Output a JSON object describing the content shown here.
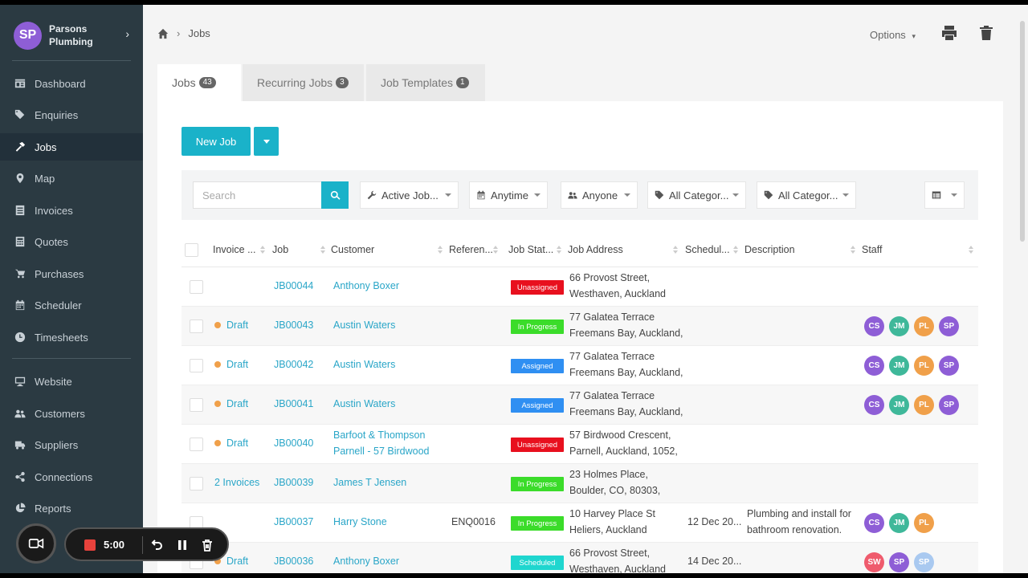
{
  "sidebar": {
    "brand": {
      "initials": "SP",
      "name": "Parsons Plumbing"
    },
    "items": [
      {
        "label": "Dashboard",
        "icon": "dashboard-icon"
      },
      {
        "label": "Enquiries",
        "icon": "tags-icon"
      },
      {
        "label": "Jobs",
        "icon": "hammer-icon",
        "active": true
      },
      {
        "label": "Map",
        "icon": "map-marker-icon"
      },
      {
        "label": "Invoices",
        "icon": "invoice-icon"
      },
      {
        "label": "Quotes",
        "icon": "calculator-icon"
      },
      {
        "label": "Purchases",
        "icon": "cart-icon"
      },
      {
        "label": "Scheduler",
        "icon": "calendar-icon"
      },
      {
        "label": "Timesheets",
        "icon": "clock-icon"
      },
      {
        "label": "Website",
        "icon": "monitor-icon"
      },
      {
        "label": "Customers",
        "icon": "users-icon"
      },
      {
        "label": "Suppliers",
        "icon": "truck-icon"
      },
      {
        "label": "Connections",
        "icon": "share-icon"
      },
      {
        "label": "Reports",
        "icon": "pie-chart-icon"
      }
    ]
  },
  "header": {
    "breadcrumb": "Jobs",
    "options_label": "Options"
  },
  "tabs": [
    {
      "label": "Jobs",
      "count": "43"
    },
    {
      "label": "Recurring Jobs",
      "count": "3"
    },
    {
      "label": "Job Templates",
      "count": "1"
    }
  ],
  "toolbar": {
    "new_job_label": "New Job"
  },
  "filters": {
    "search_placeholder": "Search",
    "status": "Active Job...",
    "time": "Anytime",
    "person": "Anyone",
    "category1": "All Categor...",
    "category2": "All Categor..."
  },
  "table": {
    "columns": [
      "Invoice ...",
      "Job",
      "Customer",
      "Referen...",
      "Job Stat...",
      "Job Address",
      "Schedul...",
      "Description",
      "Staff"
    ],
    "rows": [
      {
        "invoice": "",
        "job": "JB00044",
        "customer1": "Anthony Boxer",
        "customer2": "",
        "reference": "",
        "status": "Unassigned",
        "addr1": "66 Provost Street,",
        "addr2": "Westhaven, Auckland",
        "scheduled": "",
        "desc1": "",
        "desc2": "",
        "staff": []
      },
      {
        "invoice": "Draft",
        "job": "JB00043",
        "customer1": "Austin Waters",
        "customer2": "",
        "reference": "",
        "status": "In Progress",
        "addr1": "77 Galatea Terrace",
        "addr2": "Freemans Bay, Auckland,",
        "scheduled": "",
        "desc1": "",
        "desc2": "",
        "staff": [
          "CS",
          "JM",
          "PL",
          "SP"
        ]
      },
      {
        "invoice": "Draft",
        "job": "JB00042",
        "customer1": "Austin Waters",
        "customer2": "",
        "reference": "",
        "status": "Assigned",
        "addr1": "77 Galatea Terrace",
        "addr2": "Freemans Bay, Auckland,",
        "scheduled": "",
        "desc1": "",
        "desc2": "",
        "staff": [
          "CS",
          "JM",
          "PL",
          "SP"
        ]
      },
      {
        "invoice": "Draft",
        "job": "JB00041",
        "customer1": "Austin Waters",
        "customer2": "",
        "reference": "",
        "status": "Assigned",
        "addr1": "77 Galatea Terrace",
        "addr2": "Freemans Bay, Auckland,",
        "scheduled": "",
        "desc1": "",
        "desc2": "",
        "staff": [
          "CS",
          "JM",
          "PL",
          "SP"
        ]
      },
      {
        "invoice": "Draft",
        "job": "JB00040",
        "customer1": "Barfoot & Thompson",
        "customer2": "Parnell - 57 Birdwood",
        "reference": "",
        "status": "Unassigned",
        "addr1": "57 Birdwood Crescent,",
        "addr2": "Parnell, Auckland, 1052,",
        "scheduled": "",
        "desc1": "",
        "desc2": "",
        "staff": []
      },
      {
        "invoice": "2 Invoices",
        "job": "JB00039",
        "customer1": "James T Jensen",
        "customer2": "",
        "reference": "",
        "status": "In Progress",
        "addr1": "23 Holmes Place,",
        "addr2": "Boulder, CO, 80303,",
        "scheduled": "",
        "desc1": "",
        "desc2": "",
        "staff": []
      },
      {
        "invoice": "",
        "job": "JB00037",
        "customer1": "Harry Stone",
        "customer2": "",
        "reference": "ENQ0016",
        "status": "In Progress",
        "addr1": "10 Harvey Place St",
        "addr2": "Heliers, Auckland",
        "scheduled": "12 Dec 20...",
        "desc1": "Plumbing and install for",
        "desc2": "bathroom renovation.",
        "staff": [
          "CS",
          "JM",
          "PL"
        ]
      },
      {
        "invoice": "Draft",
        "job": "JB00036",
        "customer1": "Anthony Boxer",
        "customer2": "",
        "reference": "",
        "status": "Scheduled",
        "addr1": "66 Provost Street,",
        "addr2": "Westhaven, Auckland",
        "scheduled": "14 Dec 20...",
        "desc1": "",
        "desc2": "",
        "staff": [
          "SW",
          "SP",
          "SP"
        ]
      }
    ]
  },
  "status_colors": {
    "Unassigned": "#e8101e",
    "In Progress": "#3bdc2a",
    "Assigned": "#2f8ff2",
    "Scheduled": "#1fd6cf"
  },
  "staff_colors": {
    "CS": "#8e5ed6",
    "JM": "#3fb89a",
    "PL": "#f0a04a",
    "SP": "#8e5ed6",
    "SW": "#ef5b6d",
    "SP2": "#a9c9f0"
  },
  "recorder": {
    "time": "5:00"
  }
}
